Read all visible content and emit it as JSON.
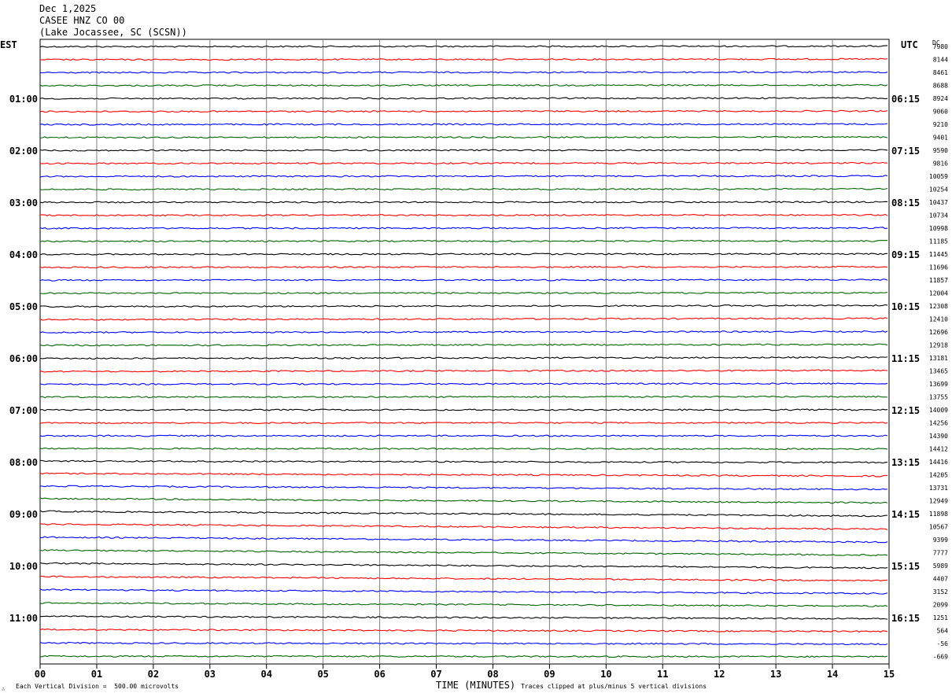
{
  "header": {
    "date": "Dec 1,2025",
    "station": "CASEE HNZ CO 00",
    "location": "(Lake Jocassee, SC (SCSN))"
  },
  "left_zone_label": "EST",
  "right_zone_label": "UTC",
  "dc_label": "DC",
  "footer": {
    "scale_note": "Each Vertical Division =  500.00 microvolts",
    "clip_note": "Traces clipped at plus/minus 5 vertical divisions",
    "publisher_mark": "∴"
  },
  "chart_data": {
    "type": "line",
    "xlabel": "TIME (MINUTES)",
    "xlim": [
      0,
      15
    ],
    "x_ticks": [
      "00",
      "01",
      "02",
      "03",
      "04",
      "05",
      "06",
      "07",
      "08",
      "09",
      "10",
      "11",
      "12",
      "13",
      "14",
      "15"
    ],
    "trace_colors": [
      "#000000",
      "#ff0000",
      "#0000ff",
      "#006400"
    ],
    "est_hour_labels": [
      "01:00",
      "02:00",
      "03:00",
      "04:00",
      "05:00",
      "06:00",
      "07:00",
      "08:00",
      "09:00",
      "10:00",
      "11:00"
    ],
    "utc_hour_labels": [
      "06:15",
      "07:15",
      "08:15",
      "09:15",
      "10:15",
      "11:15",
      "12:15",
      "13:15",
      "14:15",
      "15:15",
      "16:15"
    ],
    "dc_offsets": [
      "7980",
      "8144",
      "8461",
      "8688",
      "8924",
      "9060",
      "9210",
      "9401",
      "9590",
      "9816",
      "10059",
      "10254",
      "10437",
      "10734",
      "10998",
      "11185",
      "11445",
      "11696",
      "11857",
      "12004",
      "12308",
      "12410",
      "12696",
      "12918",
      "13181",
      "13465",
      "13699",
      "13755",
      "14009",
      "14256",
      "14390",
      "14412",
      "14416",
      "14205",
      "13731",
      "12949",
      "11898",
      "10567",
      "9399",
      "7777",
      "5989",
      "4407",
      "3152",
      "2099",
      "1251",
      "564",
      "-56",
      "-669"
    ],
    "drift_divisions": [
      0.12,
      0.14,
      0.12,
      0.13,
      0.13,
      0.12,
      0.11,
      0.1,
      0.09,
      0.12,
      0.1,
      0.09,
      0.07,
      0.08,
      0.1,
      0.09,
      0.08,
      0.12,
      0.1,
      0.09,
      0.3,
      0.3,
      0.24,
      0.25,
      0.28,
      0.3,
      0.2,
      0.1,
      0.05,
      0.05,
      0.0,
      -0.1,
      -0.35,
      -0.65,
      -0.85,
      -1.05,
      -1.2,
      -1.3,
      -1.25,
      -1.25,
      -1.2,
      -1.05,
      -0.95,
      -0.8,
      -0.6,
      -0.48,
      -0.3,
      -0.1
    ]
  }
}
